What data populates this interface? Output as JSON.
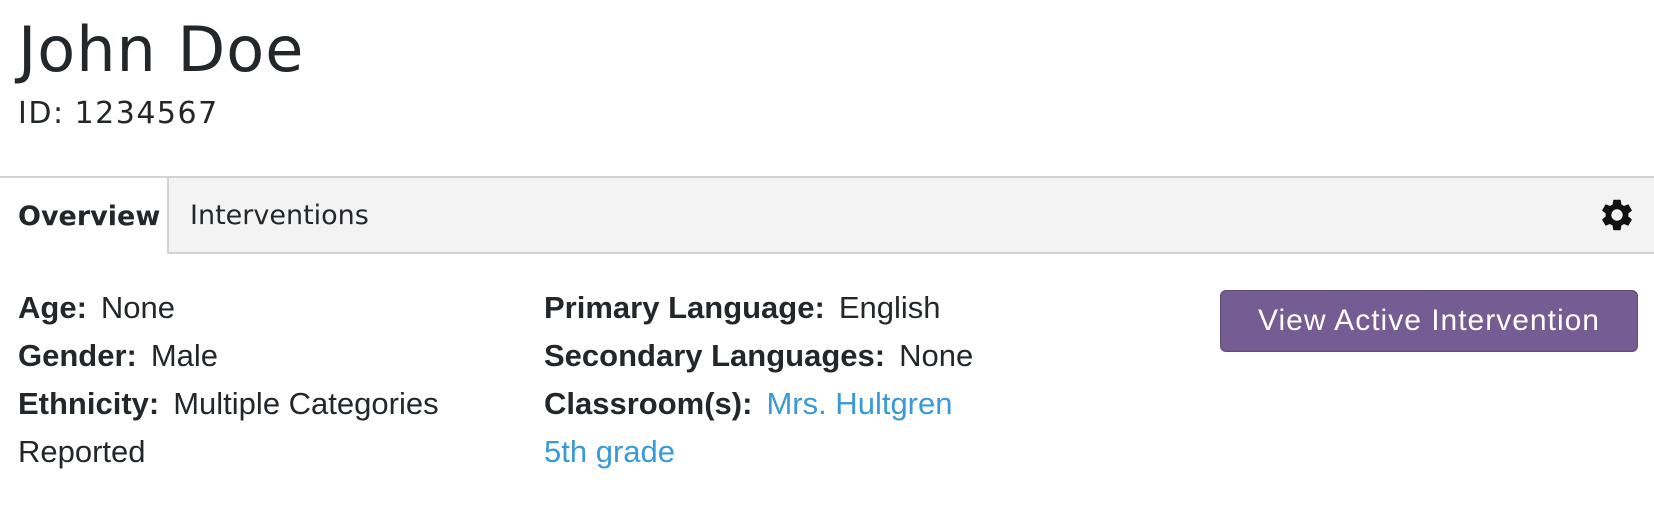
{
  "student": {
    "name": "John Doe",
    "id_label": "ID:",
    "id_value": "1234567"
  },
  "tabs": [
    {
      "label": "Overview",
      "active": true
    },
    {
      "label": "Interventions",
      "active": false
    }
  ],
  "settings": {
    "icon": "gear-icon"
  },
  "details_left": [
    {
      "label": "Age:",
      "value": "None"
    },
    {
      "label": "Gender:",
      "value": "Male"
    },
    {
      "label": "Ethnicity:",
      "value": "Multiple Categories Reported"
    }
  ],
  "details_mid": {
    "primary_language": {
      "label": "Primary Language:",
      "value": "English"
    },
    "secondary_languages": {
      "label": "Secondary Languages:",
      "value": "None"
    },
    "classrooms": {
      "label": "Classroom(s):",
      "links": [
        "Mrs. Hultgren",
        "5th grade"
      ]
    }
  },
  "actions": {
    "view_active_intervention": "View Active Intervention"
  },
  "colors": {
    "accent_button": "#755c92",
    "link": "#3a9ad9",
    "tab_bar_bg": "#f3f3f3",
    "divider": "#d2d2d2"
  }
}
